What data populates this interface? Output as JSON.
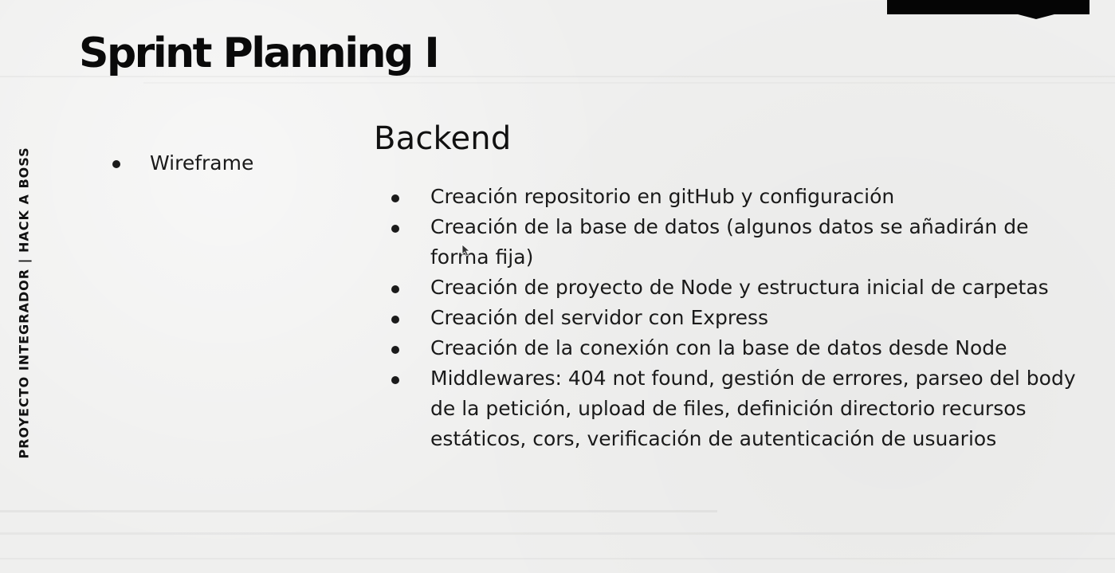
{
  "slide": {
    "title": "Sprint Planning I",
    "sidebar_text": "PROYECTO INTEGRADOR  |  HACK A BOSS",
    "left_items": [
      "Wireframe"
    ],
    "backend": {
      "heading": "Backend",
      "items": [
        "Creación repositorio en gitHub y configuración",
        "Creación de la base de datos (algunos datos se añadirán de forma fija)",
        "Creación de proyecto de Node y estructura inicial de carpetas",
        "Creación del servidor con Express",
        "Creación de la conexión con la base de datos desde Node",
        "Middlewares: 404 not found, gestión de errores, parseo del body de la petición, upload de files, definición directorio recursos estáticos, cors, verificación de autenticación de usuarios"
      ]
    },
    "icons": {
      "bullet": "bullet-dot-icon",
      "cursor": "mouse-pointer-icon"
    }
  }
}
